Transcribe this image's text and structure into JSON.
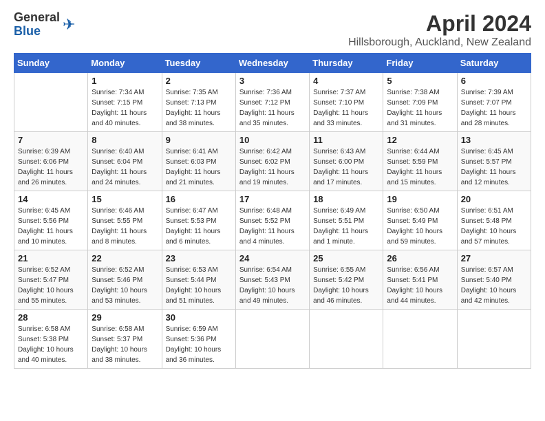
{
  "header": {
    "logo_general": "General",
    "logo_blue": "Blue",
    "month_year": "April 2024",
    "location": "Hillsborough, Auckland, New Zealand"
  },
  "days_of_week": [
    "Sunday",
    "Monday",
    "Tuesday",
    "Wednesday",
    "Thursday",
    "Friday",
    "Saturday"
  ],
  "weeks": [
    [
      {
        "day": "",
        "sunrise": "",
        "sunset": "",
        "daylight": ""
      },
      {
        "day": "1",
        "sunrise": "Sunrise: 7:34 AM",
        "sunset": "Sunset: 7:15 PM",
        "daylight": "Daylight: 11 hours and 40 minutes."
      },
      {
        "day": "2",
        "sunrise": "Sunrise: 7:35 AM",
        "sunset": "Sunset: 7:13 PM",
        "daylight": "Daylight: 11 hours and 38 minutes."
      },
      {
        "day": "3",
        "sunrise": "Sunrise: 7:36 AM",
        "sunset": "Sunset: 7:12 PM",
        "daylight": "Daylight: 11 hours and 35 minutes."
      },
      {
        "day": "4",
        "sunrise": "Sunrise: 7:37 AM",
        "sunset": "Sunset: 7:10 PM",
        "daylight": "Daylight: 11 hours and 33 minutes."
      },
      {
        "day": "5",
        "sunrise": "Sunrise: 7:38 AM",
        "sunset": "Sunset: 7:09 PM",
        "daylight": "Daylight: 11 hours and 31 minutes."
      },
      {
        "day": "6",
        "sunrise": "Sunrise: 7:39 AM",
        "sunset": "Sunset: 7:07 PM",
        "daylight": "Daylight: 11 hours and 28 minutes."
      }
    ],
    [
      {
        "day": "7",
        "sunrise": "Sunrise: 6:39 AM",
        "sunset": "Sunset: 6:06 PM",
        "daylight": "Daylight: 11 hours and 26 minutes."
      },
      {
        "day": "8",
        "sunrise": "Sunrise: 6:40 AM",
        "sunset": "Sunset: 6:04 PM",
        "daylight": "Daylight: 11 hours and 24 minutes."
      },
      {
        "day": "9",
        "sunrise": "Sunrise: 6:41 AM",
        "sunset": "Sunset: 6:03 PM",
        "daylight": "Daylight: 11 hours and 21 minutes."
      },
      {
        "day": "10",
        "sunrise": "Sunrise: 6:42 AM",
        "sunset": "Sunset: 6:02 PM",
        "daylight": "Daylight: 11 hours and 19 minutes."
      },
      {
        "day": "11",
        "sunrise": "Sunrise: 6:43 AM",
        "sunset": "Sunset: 6:00 PM",
        "daylight": "Daylight: 11 hours and 17 minutes."
      },
      {
        "day": "12",
        "sunrise": "Sunrise: 6:44 AM",
        "sunset": "Sunset: 5:59 PM",
        "daylight": "Daylight: 11 hours and 15 minutes."
      },
      {
        "day": "13",
        "sunrise": "Sunrise: 6:45 AM",
        "sunset": "Sunset: 5:57 PM",
        "daylight": "Daylight: 11 hours and 12 minutes."
      }
    ],
    [
      {
        "day": "14",
        "sunrise": "Sunrise: 6:45 AM",
        "sunset": "Sunset: 5:56 PM",
        "daylight": "Daylight: 11 hours and 10 minutes."
      },
      {
        "day": "15",
        "sunrise": "Sunrise: 6:46 AM",
        "sunset": "Sunset: 5:55 PM",
        "daylight": "Daylight: 11 hours and 8 minutes."
      },
      {
        "day": "16",
        "sunrise": "Sunrise: 6:47 AM",
        "sunset": "Sunset: 5:53 PM",
        "daylight": "Daylight: 11 hours and 6 minutes."
      },
      {
        "day": "17",
        "sunrise": "Sunrise: 6:48 AM",
        "sunset": "Sunset: 5:52 PM",
        "daylight": "Daylight: 11 hours and 4 minutes."
      },
      {
        "day": "18",
        "sunrise": "Sunrise: 6:49 AM",
        "sunset": "Sunset: 5:51 PM",
        "daylight": "Daylight: 11 hours and 1 minute."
      },
      {
        "day": "19",
        "sunrise": "Sunrise: 6:50 AM",
        "sunset": "Sunset: 5:49 PM",
        "daylight": "Daylight: 10 hours and 59 minutes."
      },
      {
        "day": "20",
        "sunrise": "Sunrise: 6:51 AM",
        "sunset": "Sunset: 5:48 PM",
        "daylight": "Daylight: 10 hours and 57 minutes."
      }
    ],
    [
      {
        "day": "21",
        "sunrise": "Sunrise: 6:52 AM",
        "sunset": "Sunset: 5:47 PM",
        "daylight": "Daylight: 10 hours and 55 minutes."
      },
      {
        "day": "22",
        "sunrise": "Sunrise: 6:52 AM",
        "sunset": "Sunset: 5:46 PM",
        "daylight": "Daylight: 10 hours and 53 minutes."
      },
      {
        "day": "23",
        "sunrise": "Sunrise: 6:53 AM",
        "sunset": "Sunset: 5:44 PM",
        "daylight": "Daylight: 10 hours and 51 minutes."
      },
      {
        "day": "24",
        "sunrise": "Sunrise: 6:54 AM",
        "sunset": "Sunset: 5:43 PM",
        "daylight": "Daylight: 10 hours and 49 minutes."
      },
      {
        "day": "25",
        "sunrise": "Sunrise: 6:55 AM",
        "sunset": "Sunset: 5:42 PM",
        "daylight": "Daylight: 10 hours and 46 minutes."
      },
      {
        "day": "26",
        "sunrise": "Sunrise: 6:56 AM",
        "sunset": "Sunset: 5:41 PM",
        "daylight": "Daylight: 10 hours and 44 minutes."
      },
      {
        "day": "27",
        "sunrise": "Sunrise: 6:57 AM",
        "sunset": "Sunset: 5:40 PM",
        "daylight": "Daylight: 10 hours and 42 minutes."
      }
    ],
    [
      {
        "day": "28",
        "sunrise": "Sunrise: 6:58 AM",
        "sunset": "Sunset: 5:38 PM",
        "daylight": "Daylight: 10 hours and 40 minutes."
      },
      {
        "day": "29",
        "sunrise": "Sunrise: 6:58 AM",
        "sunset": "Sunset: 5:37 PM",
        "daylight": "Daylight: 10 hours and 38 minutes."
      },
      {
        "day": "30",
        "sunrise": "Sunrise: 6:59 AM",
        "sunset": "Sunset: 5:36 PM",
        "daylight": "Daylight: 10 hours and 36 minutes."
      },
      {
        "day": "",
        "sunrise": "",
        "sunset": "",
        "daylight": ""
      },
      {
        "day": "",
        "sunrise": "",
        "sunset": "",
        "daylight": ""
      },
      {
        "day": "",
        "sunrise": "",
        "sunset": "",
        "daylight": ""
      },
      {
        "day": "",
        "sunrise": "",
        "sunset": "",
        "daylight": ""
      }
    ]
  ]
}
